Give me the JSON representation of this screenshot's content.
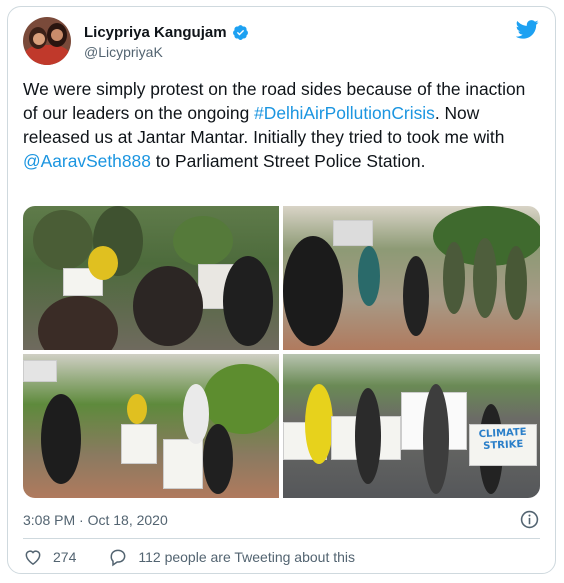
{
  "author": {
    "display_name": "Licypriya Kangujam",
    "handle": "@LicypriyaK",
    "verified": true
  },
  "tweet": {
    "text_1": "We were simply protest on the road sides because of the inaction of our leaders on the ongoing ",
    "hashtag": "#DelhiAirPollutionCrisis",
    "text_2": ". Now released us at Jantar Mantar. Initially they tried to took me with ",
    "mention": "@AaravSeth888",
    "text_3": " to Parliament Street Police Station."
  },
  "media": {
    "photo_count": 4,
    "signs": [
      "CLIMATE STRIKE"
    ]
  },
  "meta": {
    "timestamp": "3:08 PM · Oct 18, 2020"
  },
  "actions": {
    "like_count": "274",
    "conversation_text": "112 people are Tweeting about this"
  },
  "colors": {
    "link": "#1b95e0",
    "verified": "#1da1f2",
    "twitter_brand": "#1da1f2",
    "border": "#cfd9de",
    "secondary_text": "#536471"
  },
  "icons": [
    "verified-badge-icon",
    "twitter-bird-icon",
    "info-icon",
    "heart-icon",
    "speech-bubble-icon"
  ]
}
